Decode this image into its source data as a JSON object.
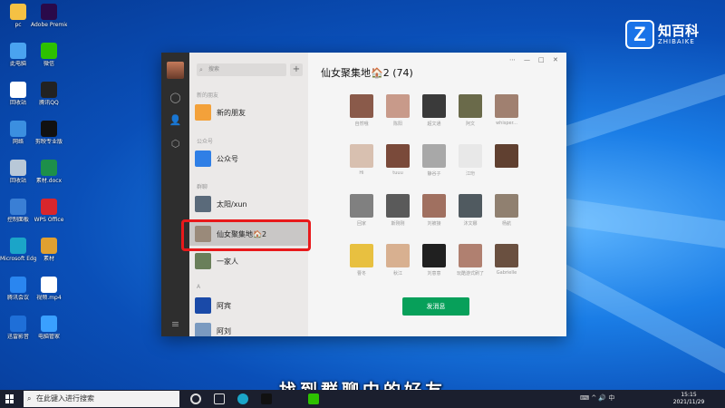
{
  "desktop_icons": [
    {
      "label": "pc",
      "icon": "pc-icon",
      "color": "#f5c144"
    },
    {
      "label": "Adobe Premiere...",
      "icon": "premiere-icon",
      "color": "#2a0a4a"
    },
    {
      "label": "此电脑",
      "icon": "computer-icon",
      "color": "#4aa3f0"
    },
    {
      "label": "微信",
      "icon": "wechat-icon",
      "color": "#2dc100"
    },
    {
      "label": "回收站",
      "icon": "doc-icon",
      "color": "#ffffff"
    },
    {
      "label": "腾讯QQ",
      "icon": "qq-icon",
      "color": "#222222"
    },
    {
      "label": "网络",
      "icon": "network-icon",
      "color": "#3b8fe0"
    },
    {
      "label": "剪映专业版",
      "icon": "capcut-icon",
      "color": "#111111"
    },
    {
      "label": "回收站",
      "icon": "recycle-bin-icon",
      "color": "#b8c8d8"
    },
    {
      "label": "素材.docx",
      "icon": "excel-icon",
      "color": "#1d8f4a"
    },
    {
      "label": "控制面板",
      "icon": "control-panel-icon",
      "color": "#3a7fd5"
    },
    {
      "label": "WPS Office",
      "icon": "wps-icon",
      "color": "#d8262c"
    },
    {
      "label": "Microsoft Edge",
      "icon": "edge-icon",
      "color": "#1ba5c8"
    },
    {
      "label": "素材",
      "icon": "folder-icon",
      "color": "#e0a030"
    },
    {
      "label": "腾讯会议",
      "icon": "meeting-icon",
      "color": "#2a86f0"
    },
    {
      "label": "视频.mp4",
      "icon": "doc-icon",
      "color": "#ffffff"
    },
    {
      "label": "迅雷影音",
      "icon": "player-icon",
      "color": "#1f6fd8"
    },
    {
      "label": "电脑管家",
      "icon": "pc-manager-icon",
      "color": "#3aa0ff"
    }
  ],
  "brand": {
    "name_cn": "知百科",
    "name_en": "ZHIBAIKE",
    "logo": "Z"
  },
  "wechat": {
    "search_placeholder": "搜索",
    "add_label": "+",
    "sections": {
      "new_friends": "新的朋友",
      "official": "公众号",
      "groups": "群聊",
      "a": "A"
    },
    "contacts": [
      {
        "name": "新的朋友",
        "color": "#f3a13a"
      },
      {
        "name": "公众号",
        "color": "#2f7fe6"
      },
      {
        "name": "太阳/xun",
        "color": "#5a6a7a"
      },
      {
        "name": "仙女聚集地🏠2",
        "color": "#9a8a7a"
      },
      {
        "name": "一家人",
        "color": "#6a7f5a"
      },
      {
        "name": "阿宾",
        "color": "#1a4aa8"
      },
      {
        "name": "阿刘",
        "color": "#7a9ac0"
      }
    ],
    "group_title": "仙女聚集地🏠2 (74)",
    "window_controls": [
      "⋯",
      "—",
      "□",
      "✕"
    ],
    "members": [
      {
        "name": "自然哦",
        "color": "#8a5a4a"
      },
      {
        "name": "陈阳",
        "color": "#c89a8a"
      },
      {
        "name": "超文通",
        "color": "#3a3a3a"
      },
      {
        "name": "阿文",
        "color": "#6a6a4a"
      },
      {
        "name": "whisper...",
        "color": "#a08070"
      },
      {
        "name": "Hi",
        "color": "#d8c0b0"
      },
      {
        "name": "tuuu",
        "color": "#7a4a3a"
      },
      {
        "name": "静谷子",
        "color": "#a8a8a8"
      },
      {
        "name": "江珩",
        "color": "#e8e8e8"
      },
      {
        "name": "",
        "color": "#604030"
      },
      {
        "name": "回家",
        "color": "#808080"
      },
      {
        "name": "斯刚刚",
        "color": "#5a5a5a"
      },
      {
        "name": "刘被接",
        "color": "#a07060"
      },
      {
        "name": "沐文娜",
        "color": "#505a60"
      },
      {
        "name": "杨航",
        "color": "#908070"
      },
      {
        "name": "曹冬",
        "color": "#e8c040"
      },
      {
        "name": "秋江",
        "color": "#d8b090"
      },
      {
        "name": "刘意意",
        "color": "#202020"
      },
      {
        "name": "玩酷游式刷了",
        "color": "#b08070"
      },
      {
        "name": "Gabrielle",
        "color": "#6a5040"
      }
    ],
    "send_label": "发消息"
  },
  "subtitle": "找到群聊中的好友",
  "taskbar": {
    "search_placeholder": "在此键入进行搜索",
    "tray_text": "⌨ ^ 🔊 中",
    "time": "15:15",
    "date": "2021/11/29"
  }
}
